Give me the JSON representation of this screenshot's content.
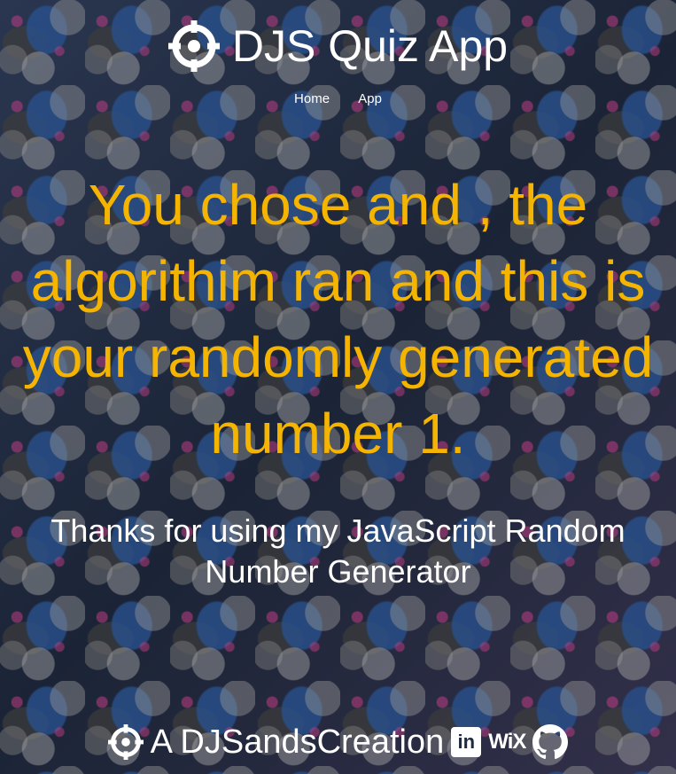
{
  "header": {
    "title": "DJS Quiz App",
    "icon": "crosshair-icon"
  },
  "nav": {
    "items": [
      {
        "label": "Home"
      },
      {
        "label": "App"
      }
    ]
  },
  "main": {
    "result_text": "You chose and , the algorithim ran and this is your randomly generated number 1.",
    "thanks_text": "Thanks for using my JavaScript Random Number Generator"
  },
  "footer": {
    "text": "A DJSandsCreation",
    "icon": "crosshair-icon",
    "social": {
      "linkedin_label": "in",
      "wix_label": "WiX",
      "github_icon": "github-icon"
    }
  },
  "colors": {
    "accent": "#f5b400",
    "text": "#ffffff"
  }
}
